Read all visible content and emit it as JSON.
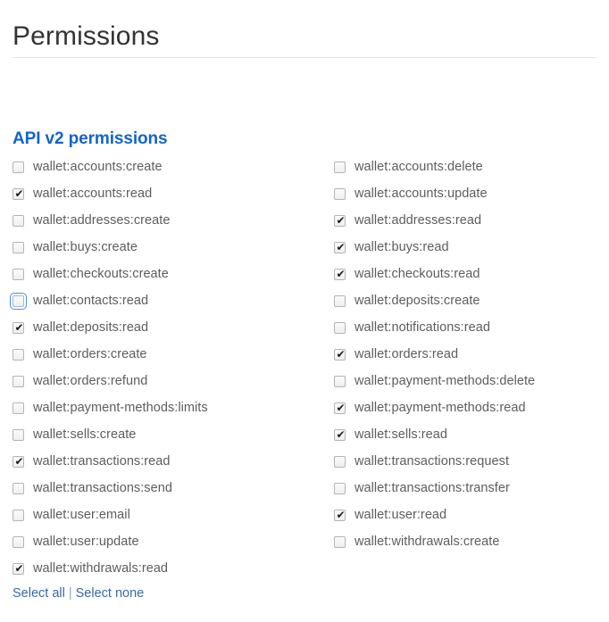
{
  "header": {
    "title": "Permissions"
  },
  "section": {
    "heading": "API v2 permissions",
    "heading_color": "#1464c8"
  },
  "permissions": {
    "left_column": [
      {
        "label": "wallet:accounts:create",
        "checked": false,
        "focused": false
      },
      {
        "label": "wallet:accounts:read",
        "checked": true,
        "focused": false
      },
      {
        "label": "wallet:addresses:create",
        "checked": false,
        "focused": false
      },
      {
        "label": "wallet:buys:create",
        "checked": false,
        "focused": false
      },
      {
        "label": "wallet:checkouts:create",
        "checked": false,
        "focused": false
      },
      {
        "label": "wallet:contacts:read",
        "checked": false,
        "focused": true
      },
      {
        "label": "wallet:deposits:read",
        "checked": true,
        "focused": false
      },
      {
        "label": "wallet:orders:create",
        "checked": false,
        "focused": false
      },
      {
        "label": "wallet:orders:refund",
        "checked": false,
        "focused": false
      },
      {
        "label": "wallet:payment-methods:limits",
        "checked": false,
        "focused": false
      },
      {
        "label": "wallet:sells:create",
        "checked": false,
        "focused": false
      },
      {
        "label": "wallet:transactions:read",
        "checked": true,
        "focused": false
      },
      {
        "label": "wallet:transactions:send",
        "checked": false,
        "focused": false
      },
      {
        "label": "wallet:user:email",
        "checked": false,
        "focused": false
      },
      {
        "label": "wallet:user:update",
        "checked": false,
        "focused": false
      },
      {
        "label": "wallet:withdrawals:read",
        "checked": true,
        "focused": false
      }
    ],
    "right_column": [
      {
        "label": "wallet:accounts:delete",
        "checked": false,
        "focused": false
      },
      {
        "label": "wallet:accounts:update",
        "checked": false,
        "focused": false
      },
      {
        "label": "wallet:addresses:read",
        "checked": true,
        "focused": false
      },
      {
        "label": "wallet:buys:read",
        "checked": true,
        "focused": false
      },
      {
        "label": "wallet:checkouts:read",
        "checked": true,
        "focused": false
      },
      {
        "label": "wallet:deposits:create",
        "checked": false,
        "focused": false
      },
      {
        "label": "wallet:notifications:read",
        "checked": false,
        "focused": false
      },
      {
        "label": "wallet:orders:read",
        "checked": true,
        "focused": false
      },
      {
        "label": "wallet:payment-methods:delete",
        "checked": false,
        "focused": false
      },
      {
        "label": "wallet:payment-methods:read",
        "checked": true,
        "focused": false
      },
      {
        "label": "wallet:sells:read",
        "checked": true,
        "focused": false
      },
      {
        "label": "wallet:transactions:request",
        "checked": false,
        "focused": false
      },
      {
        "label": "wallet:transactions:transfer",
        "checked": false,
        "focused": false
      },
      {
        "label": "wallet:user:read",
        "checked": true,
        "focused": false
      },
      {
        "label": "wallet:withdrawals:create",
        "checked": false,
        "focused": false
      }
    ],
    "check_glyph": "✔"
  },
  "footer": {
    "select_all": "Select all",
    "separator": "|",
    "select_none": "Select none",
    "link_color": "#37699f"
  }
}
